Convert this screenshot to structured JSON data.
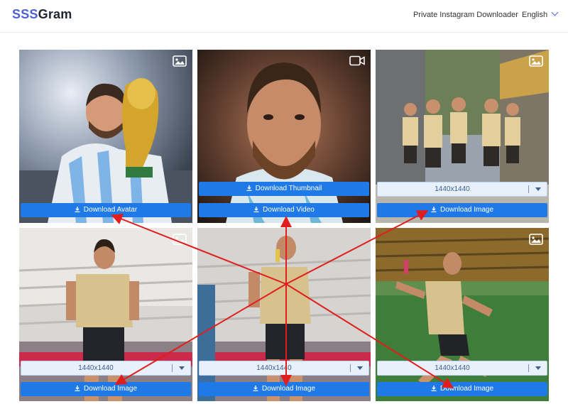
{
  "header": {
    "logo_part1": "SSS",
    "logo_part2": "Gram",
    "nav_link": "Private Instagram Downloader",
    "language": "English"
  },
  "colors": {
    "accent": "#1f7ae8",
    "logo_blue": "#4f5fd6",
    "annotation_red": "#e11d1d"
  },
  "cards": [
    {
      "media_icon": "image-icon",
      "download_label": "Download Avatar"
    },
    {
      "media_icon": "video-icon",
      "thumbnail_label": "Download Thumbnail",
      "download_label": "Download Video"
    },
    {
      "media_icon": "image-icon",
      "resolution": "1440x1440",
      "download_label": "Download Image"
    },
    {
      "media_icon": "image-icon",
      "resolution": "1440x1440",
      "download_label": "Download Image"
    },
    {
      "media_icon": "image-icon",
      "resolution": "1440x1440",
      "download_label": "Download Image"
    },
    {
      "media_icon": "image-icon",
      "resolution": "1440x1440",
      "download_label": "Download Image"
    }
  ]
}
